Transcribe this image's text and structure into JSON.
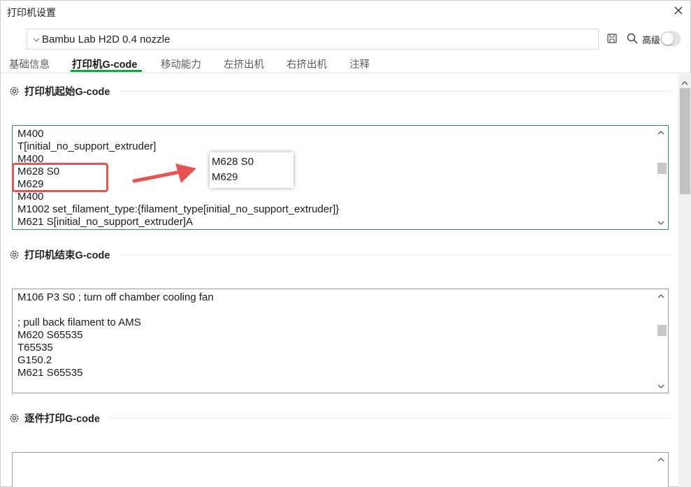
{
  "window": {
    "title": "打印机设置"
  },
  "preset": {
    "value": "Bambu Lab H2D 0.4 nozzle"
  },
  "toolbar": {
    "advanced_label": "高级",
    "advanced_on": false
  },
  "tabs": [
    {
      "label": "基础信息"
    },
    {
      "label": "打印机G-code"
    },
    {
      "label": "移动能力"
    },
    {
      "label": "左挤出机"
    },
    {
      "label": "右挤出机"
    },
    {
      "label": "注释"
    }
  ],
  "active_tab": "打印机G-code",
  "sections": [
    {
      "title": "打印机起始G-code",
      "lines": [
        "M400",
        "T[initial_no_support_extruder]",
        "M400",
        "M628 S0",
        "M629",
        "M400",
        "M1002 set_filament_type:{filament_type[initial_no_support_extruder]}",
        "M621 S[initial_no_support_extruder]A"
      ]
    },
    {
      "title": "打印机结束G-code",
      "lines": [
        "M106 P3 S0 ; turn off chamber cooling fan",
        "",
        "; pull back filament to AMS",
        "M620 S65535",
        "T65535",
        "G150.2",
        "M621 S65535"
      ]
    },
    {
      "title": "逐件打印G-code",
      "lines": []
    }
  ],
  "callout": {
    "lines": [
      "M628 S0",
      "M629"
    ]
  },
  "colors": {
    "accent": "#00ae42",
    "highlight": "#e55353",
    "focus_border": "#2e8c7a"
  }
}
